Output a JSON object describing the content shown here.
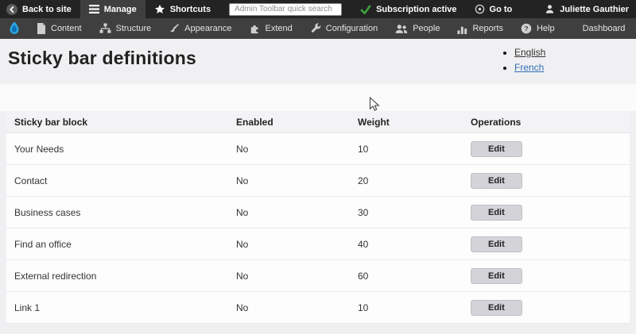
{
  "topbar": {
    "back_label": "Back to site",
    "manage_label": "Manage",
    "shortcuts_label": "Shortcuts",
    "search_placeholder": "Admin Toolbar quick search",
    "subscription_label": "Subscription active",
    "goto_label": "Go to",
    "user_name": "Juliette Gauthier",
    "icons": [
      "back-circle-icon",
      "hamburger-icon",
      "star-icon",
      "check-icon",
      "target-icon",
      "user-icon"
    ]
  },
  "admin_menu": {
    "items": [
      {
        "label": "Content",
        "icon": "file-icon"
      },
      {
        "label": "Structure",
        "icon": "sitemap-icon"
      },
      {
        "label": "Appearance",
        "icon": "brush-icon"
      },
      {
        "label": "Extend",
        "icon": "puzzle-icon"
      },
      {
        "label": "Configuration",
        "icon": "wrench-icon"
      },
      {
        "label": "People",
        "icon": "people-icon"
      },
      {
        "label": "Reports",
        "icon": "bar-chart-icon"
      },
      {
        "label": "Help",
        "icon": "question-circle-icon"
      },
      {
        "label": "Dashboard",
        "icon": null
      }
    ],
    "logo_icon": "drupal-logo",
    "collapse_icon": "collapse-left-icon"
  },
  "page": {
    "title": "Sticky bar definitions",
    "languages": [
      {
        "label": "English",
        "active": true
      },
      {
        "label": "French",
        "active": false
      }
    ]
  },
  "table": {
    "headers": [
      "Sticky bar block",
      "Enabled",
      "Weight",
      "Operations"
    ],
    "edit_label": "Edit",
    "rows": [
      {
        "block": "Your Needs",
        "enabled": "No",
        "weight": "10"
      },
      {
        "block": "Contact",
        "enabled": "No",
        "weight": "20"
      },
      {
        "block": "Business cases",
        "enabled": "No",
        "weight": "30"
      },
      {
        "block": "Find an office",
        "enabled": "No",
        "weight": "40"
      },
      {
        "block": "External redirection",
        "enabled": "No",
        "weight": "60"
      },
      {
        "block": "Link 1",
        "enabled": "No",
        "weight": "10"
      }
    ]
  },
  "colors": {
    "topbar_bg": "#232323",
    "tray_bg": "#3f3f3f",
    "accent_green": "#3fa33f",
    "link_blue": "#2f6fb7",
    "drupal_blue": "#29a8df"
  }
}
